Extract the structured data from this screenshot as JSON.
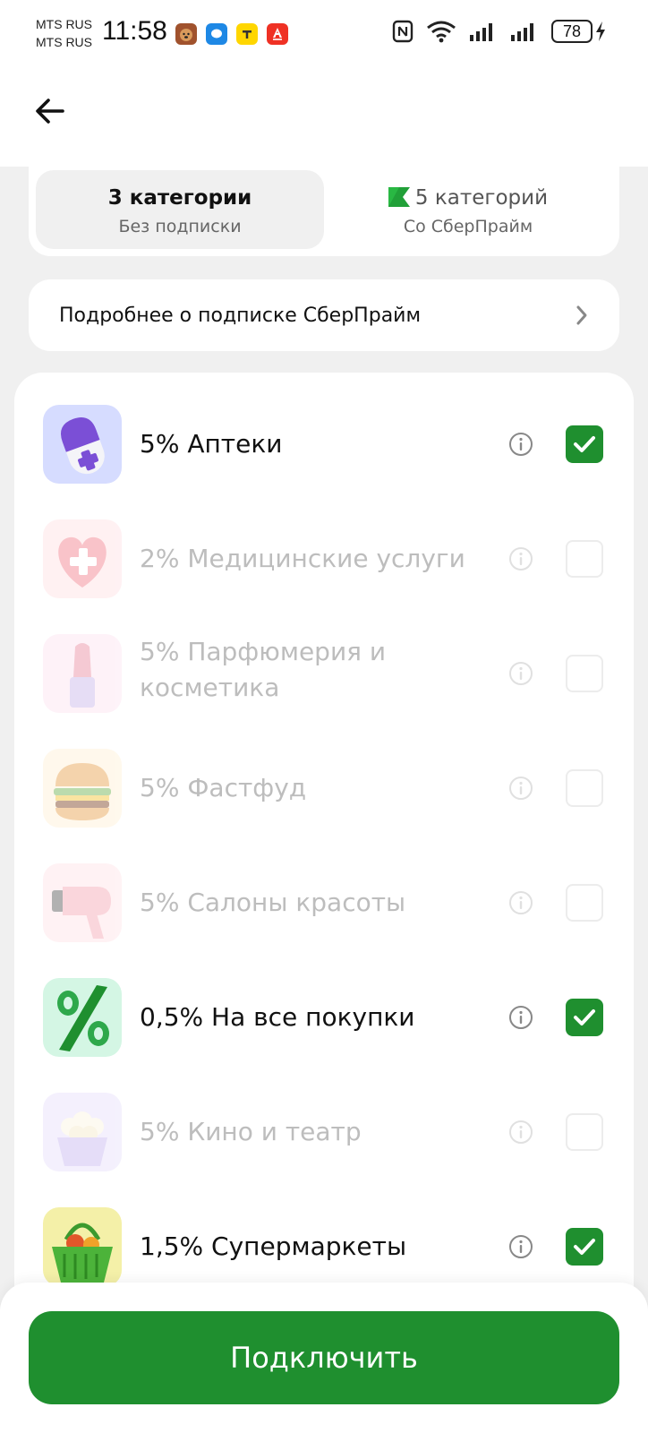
{
  "status_bar": {
    "carrier_1": "MTS RUS",
    "carrier_2": "MTS RUS",
    "time": "11:58",
    "battery": "78"
  },
  "tabs": [
    {
      "title": "3 категории",
      "subtitle": "Без подписки",
      "active": true
    },
    {
      "title": "5 категорий",
      "subtitle": "Со СберПрайм",
      "active": false
    }
  ],
  "info_link": {
    "label": "Подробнее о подписке СберПрайм"
  },
  "categories": [
    {
      "label": "5% Аптеки",
      "checked": true,
      "enabled": true,
      "icon": "pill-icon"
    },
    {
      "label": "2% Медицинские услуги",
      "checked": false,
      "enabled": false,
      "icon": "heart-cross-icon"
    },
    {
      "label": "5% Парфюмерия и косметика",
      "checked": false,
      "enabled": false,
      "icon": "lipstick-icon"
    },
    {
      "label": "5% Фастфуд",
      "checked": false,
      "enabled": false,
      "icon": "burger-icon"
    },
    {
      "label": "5% Салоны красоты",
      "checked": false,
      "enabled": false,
      "icon": "hair-dryer-icon"
    },
    {
      "label": "0,5% На все покупки",
      "checked": true,
      "enabled": true,
      "icon": "percent-icon"
    },
    {
      "label": "5% Кино и театр",
      "checked": false,
      "enabled": false,
      "icon": "popcorn-icon"
    },
    {
      "label": "1,5% Супермаркеты",
      "checked": true,
      "enabled": true,
      "icon": "basket-icon"
    }
  ],
  "footer": {
    "connect_label": "Подключить"
  },
  "colors": {
    "accent": "#1f8f2f",
    "background": "#f0f0f0"
  }
}
